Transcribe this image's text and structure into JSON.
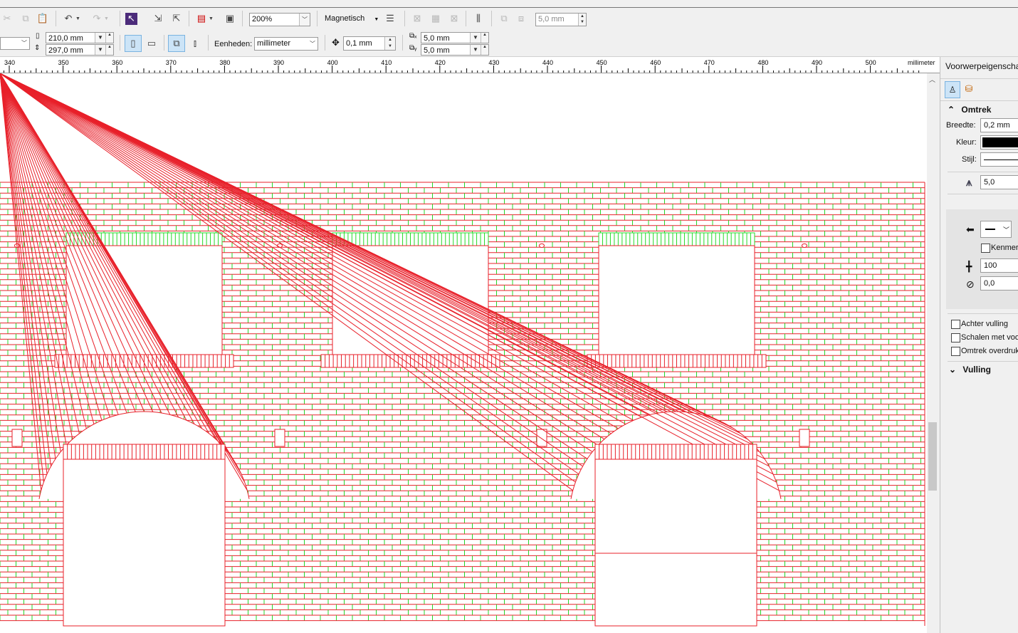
{
  "toolbar": {
    "zoom": "200%",
    "snap_label": "Magnetisch",
    "nudge_value": "5,0 mm"
  },
  "propbar": {
    "width": "210,0 mm",
    "height": "297,0 mm",
    "units_label": "Eenheden:",
    "units_value": "millimeter",
    "nudge": "0,1 mm",
    "dup_x": "5,0 mm",
    "dup_y": "5,0 mm"
  },
  "ruler": {
    "ticks": [
      "340",
      "350",
      "360",
      "370",
      "380",
      "390",
      "400",
      "410",
      "420",
      "430",
      "440",
      "450",
      "460",
      "470",
      "480",
      "490",
      "500"
    ],
    "unit": "millimeter"
  },
  "panel": {
    "title": "Voorwerpeigenscha",
    "section_outline": "Omtrek",
    "width_label": "Breedte:",
    "width_value": "0,2 mm",
    "color_label": "Kleur:",
    "color_value": "#000000",
    "style_label": "Stijl:",
    "miter_value": "5,0",
    "calligraphy_label": "Kenmerk",
    "stretch_value": "100",
    "angle_value": "0,0",
    "behind_fill_label": "Achter vulling",
    "scale_label": "Schalen met voo",
    "overprint_label": "Omtrek overdruk",
    "section_fill": "Vulling"
  },
  "colors": {
    "brick_red": "#e8202a",
    "brick_green": "#27d92b"
  }
}
